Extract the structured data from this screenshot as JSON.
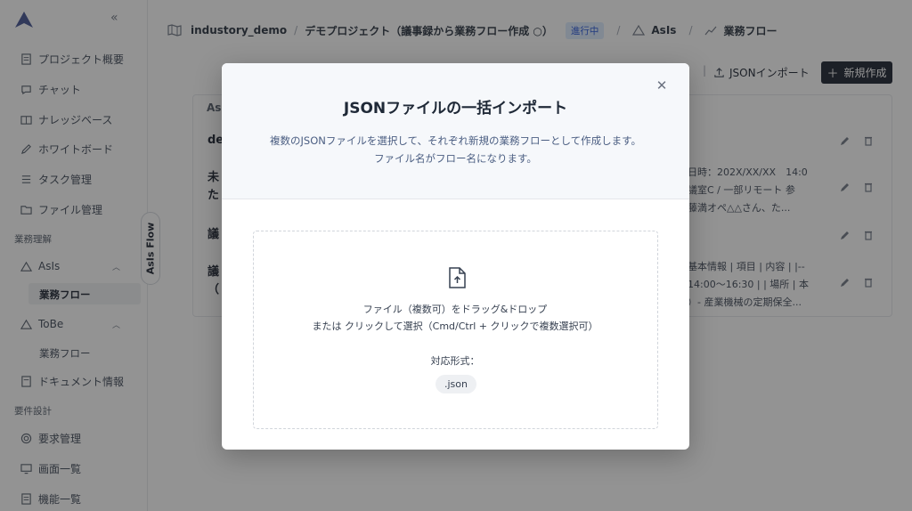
{
  "sidebar": {
    "nav": [
      {
        "label": "プロジェクト概要",
        "icon": "document-icon"
      },
      {
        "label": "チャット",
        "icon": "chat-icon"
      },
      {
        "label": "ナレッジベース",
        "icon": "book-icon"
      },
      {
        "label": "ホワイトボード",
        "icon": "pen-icon"
      },
      {
        "label": "タスク管理",
        "icon": "list-icon"
      },
      {
        "label": "ファイル管理",
        "icon": "folder-icon"
      }
    ],
    "section_business": "業務理解",
    "asis": {
      "label": "AsIs",
      "sub": "業務フロー"
    },
    "tobe": {
      "label": "ToBe",
      "sub": "業務フロー"
    },
    "doc_info": "ドキュメント情報",
    "section_requirements": "要件設計",
    "req_nav": [
      {
        "label": "要求管理",
        "icon": "target-icon"
      },
      {
        "label": "画面一覧",
        "icon": "monitor-icon"
      },
      {
        "label": "機能一覧",
        "icon": "list-icon"
      }
    ],
    "flow_tab": "AsIs Flow"
  },
  "header": {
    "workspace": "industory_demo",
    "project": "デモプロジェクト（議事録から業務フロー作成 ○）",
    "status": "進行中",
    "asis_link": "AsIs",
    "flow_link": "業務フロー"
  },
  "toolbar": {
    "import_label": "JSONインポート",
    "new_label": "新規作成"
  },
  "table": {
    "header": "AsIs",
    "rows": [
      {
        "title": "de",
        "desc": ""
      },
      {
        "title": "未\nた",
        "desc": "日時：202X/XX/XX　14:0\n議室C / 一部リモート 参\n藤満オペ△△さん、た..."
      },
      {
        "title": "議",
        "desc": ""
      },
      {
        "title": "議\n（",
        "desc": "基本情報 | 項目 | 内容 | |--\n14:00〜16:30 | | 場所 | 本\n）- 産業機械の定期保全..."
      }
    ]
  },
  "modal": {
    "title": "JSONファイルの一括インポート",
    "desc_line1": "複数のJSONファイルを選択して、それぞれ新規の業務フローとして作成します。",
    "desc_line2": "ファイル名がフロー名になります。",
    "drop_line1": "ファイル（複数可）をドラッグ&ドロップ",
    "drop_line2": "または クリックして選択（Cmd/Ctrl + クリックで複数選択可）",
    "formats_label": "対応形式：",
    "format": ".json",
    "close_icon": "close-icon",
    "upload_icon": "file-upload-icon"
  }
}
